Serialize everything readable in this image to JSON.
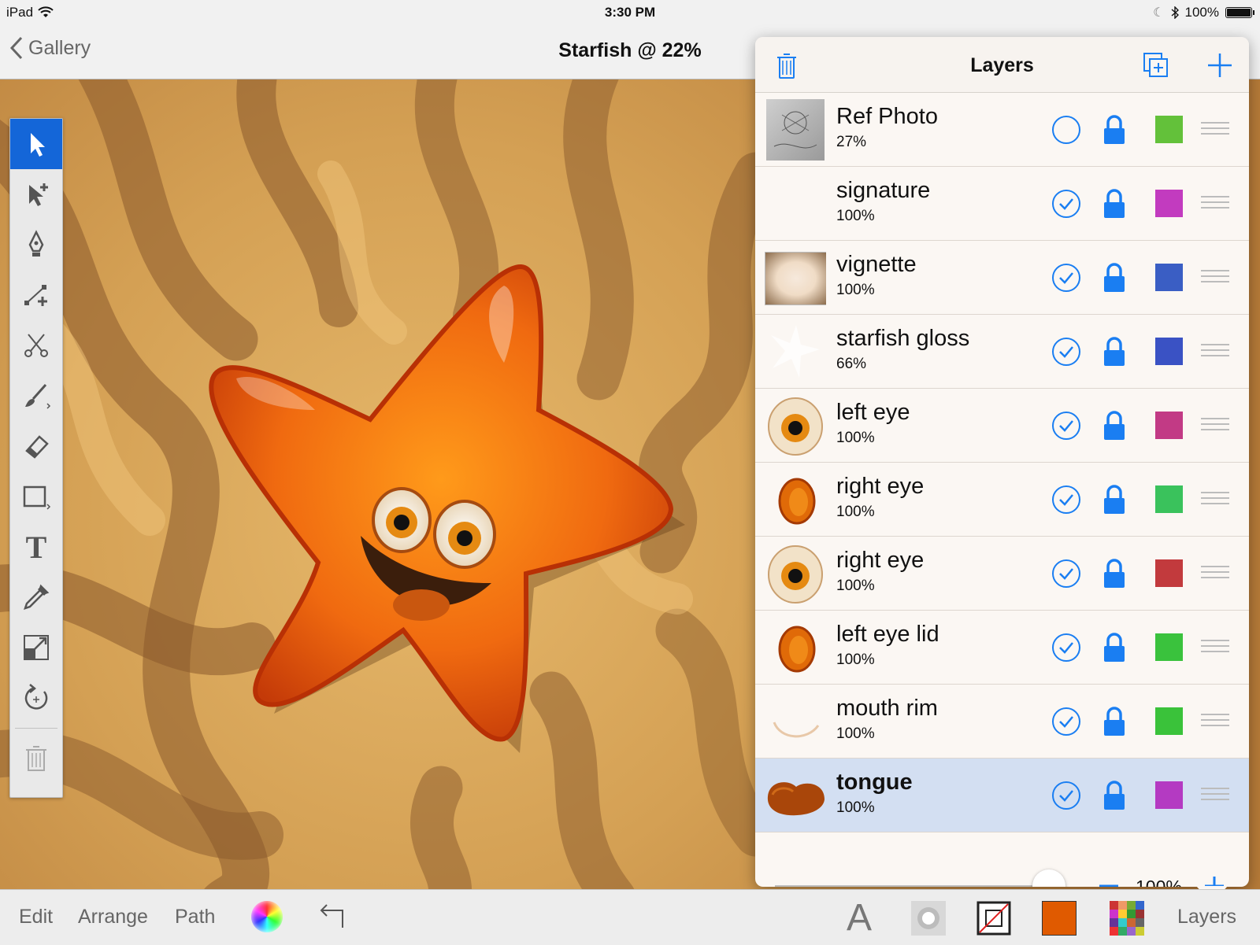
{
  "status_bar": {
    "device": "iPad",
    "time": "3:30 PM",
    "battery": "100%"
  },
  "navbar": {
    "back_label": "Gallery",
    "title": "Starfish @ 22%"
  },
  "toolbox": {
    "tools": [
      "select",
      "direct-select",
      "pen",
      "add-node",
      "scissors",
      "brush",
      "eraser",
      "rectangle",
      "text",
      "eyedropper",
      "scale",
      "rotate",
      "delete"
    ],
    "active_tool": "select",
    "text_tool_glyph": "T"
  },
  "layers_panel": {
    "title": "Layers",
    "layers": [
      {
        "name": "Ref Photo",
        "opacity": "27%",
        "visible": false,
        "color": "#63c13a",
        "thumb": "photo"
      },
      {
        "name": "signature",
        "opacity": "100%",
        "visible": true,
        "color": "#c23bbf",
        "thumb": "blank"
      },
      {
        "name": "vignette",
        "opacity": "100%",
        "visible": true,
        "color": "#3a5ec4",
        "thumb": "vignette"
      },
      {
        "name": "starfish gloss",
        "opacity": "66%",
        "visible": true,
        "color": "#3a52c4",
        "thumb": "gloss"
      },
      {
        "name": "left eye",
        "opacity": "100%",
        "visible": true,
        "color": "#c23a85",
        "thumb": "eye"
      },
      {
        "name": "right eye",
        "opacity": "100%",
        "visible": true,
        "color": "#3ac25c",
        "thumb": "eyelid"
      },
      {
        "name": "right eye",
        "opacity": "100%",
        "visible": true,
        "color": "#c23a3d",
        "thumb": "eye"
      },
      {
        "name": "left eye lid",
        "opacity": "100%",
        "visible": true,
        "color": "#3ac23d",
        "thumb": "eyelid"
      },
      {
        "name": "mouth rim",
        "opacity": "100%",
        "visible": true,
        "color": "#3ac23a",
        "thumb": "rim"
      },
      {
        "name": "tongue",
        "opacity": "100%",
        "visible": true,
        "color": "#b43ac2",
        "thumb": "tongue",
        "selected": true
      }
    ],
    "layer_opacity": "100%",
    "layer_opacity_level": 1.0
  },
  "bottom_bar": {
    "edit_label": "Edit",
    "arrange_label": "Arrange",
    "path_label": "Path",
    "font_glyph": "A",
    "fill_color": "#e05a00",
    "layers_label": "Layers"
  },
  "colors": {
    "accent": "#1a7ef2",
    "active_tool_bg": "#1466d8",
    "selected_row": "#d3dff2"
  }
}
